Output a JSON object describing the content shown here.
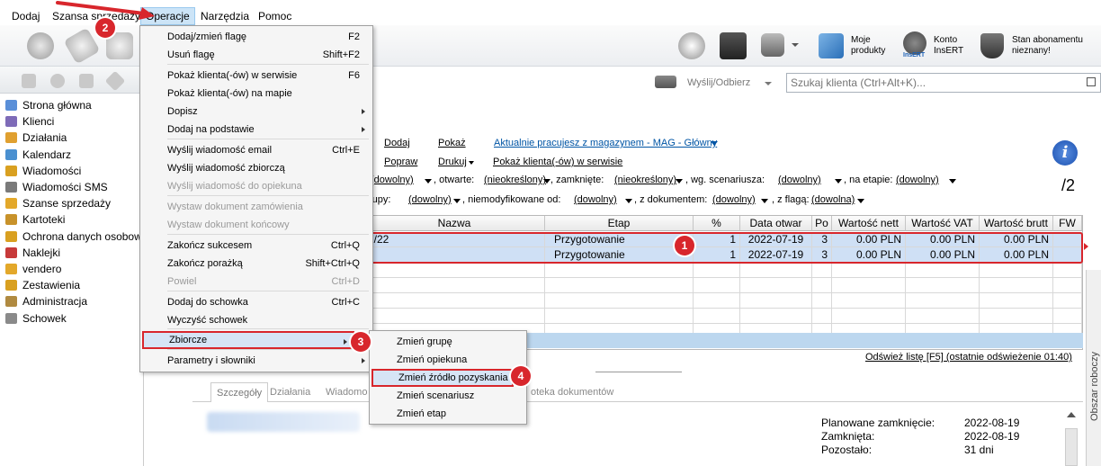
{
  "menubar": {
    "items": [
      "Dodaj",
      "Szansa sprzedaży",
      "Operacje",
      "Narzędzia",
      "Pomoc"
    ]
  },
  "toolbar": {
    "moje_produkty": "Moje\nprodukty",
    "konto_insert": "Konto\nInsERT",
    "subscription": "Stan abonamentu\nnieznany!",
    "insert_logo": "InsERT"
  },
  "sidebar": {
    "items": [
      {
        "label": "Strona główna",
        "color": "#5a8fd8"
      },
      {
        "label": "Klienci",
        "color": "#7e6bb8"
      },
      {
        "label": "Działania",
        "color": "#e0a030"
      },
      {
        "label": "Kalendarz",
        "color": "#4a90d0"
      },
      {
        "label": "Wiadomości",
        "color": "#d9a020"
      },
      {
        "label": "Wiadomości SMS",
        "color": "#7a7a7a"
      },
      {
        "label": "Szanse sprzedaży",
        "color": "#e3a82a"
      },
      {
        "label": "Kartoteki",
        "color": "#c8922a"
      },
      {
        "label": "Ochrona danych osobowych",
        "color": "#d9a020"
      },
      {
        "label": "Naklejki",
        "color": "#c73a3a"
      },
      {
        "label": "vendero",
        "color": "#e3a82a"
      },
      {
        "label": "Zestawienia",
        "color": "#d9a020"
      },
      {
        "label": "Administracja",
        "color": "#b08a40"
      },
      {
        "label": "Schowek",
        "color": "#8a8a8a"
      }
    ]
  },
  "main": {
    "send_receive": "Wyślij/Odbierz",
    "search_placeholder": "Szukaj klienta (Ctrl+Alt+K)...",
    "actions": {
      "dodaj": "Dodaj",
      "pokaz": "Pokaż",
      "popraw": "Popraw",
      "drukuj": "Drukuj",
      "warehouse": "Aktualnie pracujesz z magazynem - MAG - Główny",
      "show_clients": "Pokaż klienta(-ów) w serwisie"
    },
    "filters": {
      "line1": [
        {
          "label": "",
          "value": "(dowolny)"
        },
        {
          "label": ", otwarte:",
          "value": "(nieokreślony)"
        },
        {
          "label": ", zamknięte:",
          "value": "(nieokreślony)"
        },
        {
          "label": ", wg. scenariusza:",
          "value": "(dowolny)"
        },
        {
          "label": ", na etapie:",
          "value": "(dowolny)"
        }
      ],
      "line2": [
        {
          "label": "rupy:",
          "value": "(dowolny)"
        },
        {
          "label": ", niemodyfikowane od:",
          "value": "(dowolny)"
        },
        {
          "label": ", z dokumentem:",
          "value": "(dowolny)"
        },
        {
          "label": ", z flagą:",
          "value": "(dowolna)"
        }
      ]
    },
    "page_count": "/2",
    "info_icon": "i",
    "grid": {
      "headers": [
        "Nazwa",
        "Etap",
        "%",
        "Data otwar",
        "Po",
        "Wartość nett",
        "Wartość VAT",
        "Wartość brutt",
        "FW"
      ],
      "rows": [
        [
          "7/22",
          "Przygotowanie",
          "1",
          "2022-07-19",
          "3",
          "0.00 PLN",
          "0.00 PLN",
          "0.00 PLN",
          ""
        ],
        [
          "",
          "Przygotowanie",
          "1",
          "2022-07-19",
          "3",
          "0.00 PLN",
          "0.00 PLN",
          "0.00 PLN",
          ""
        ]
      ]
    },
    "refresh": "Odśwież listę [F5] (ostatnie odświeżenie 01:40)",
    "tabs": [
      "Szczegóły",
      "Działania",
      "Wiadomo",
      "oteka dokumentów"
    ],
    "details": [
      {
        "label": "Planowane zamknięcie:",
        "value": "2022-08-19"
      },
      {
        "label": "Zamknięta:",
        "value": "2022-08-19"
      },
      {
        "label": "Pozostało:",
        "value": "31 dni"
      }
    ],
    "side_panel": "Obszar roboczy"
  },
  "operacje_menu": [
    {
      "label": "Dodaj/zmień flagę",
      "shortcut": "F2"
    },
    {
      "label": "Usuń flagę",
      "shortcut": "Shift+F2"
    },
    {
      "label": "Pokaż klienta(-ów) w serwisie",
      "shortcut": "F6"
    },
    {
      "label": "Pokaż klienta(-ów) na mapie",
      "shortcut": ""
    },
    {
      "label": "Dopisz",
      "shortcut": ""
    },
    {
      "label": "Dodaj na podstawie",
      "shortcut": ""
    },
    {
      "label": "Wyślij wiadomość email",
      "shortcut": "Ctrl+E"
    },
    {
      "label": "Wyślij wiadomość zbiorczą",
      "shortcut": ""
    },
    {
      "label": "Wyślij wiadomość do opiekuna",
      "shortcut": ""
    },
    {
      "label": "Wystaw dokument zamówienia",
      "shortcut": ""
    },
    {
      "label": "Wystaw dokument końcowy",
      "shortcut": ""
    },
    {
      "label": "Zakończ sukcesem",
      "shortcut": "Ctrl+Q"
    },
    {
      "label": "Zakończ porażką",
      "shortcut": "Shift+Ctrl+Q"
    },
    {
      "label": "Powiel",
      "shortcut": "Ctrl+D"
    },
    {
      "label": "Dodaj do schowka",
      "shortcut": "Ctrl+C"
    },
    {
      "label": "Wyczyść schowek",
      "shortcut": ""
    },
    {
      "label": "Zbiorcze",
      "shortcut": ""
    },
    {
      "label": "Parametry i słowniki",
      "shortcut": ""
    }
  ],
  "zbiorcze_submenu": [
    "Zmień grupę",
    "Zmień opiekuna",
    "Zmień źródło pozyskania",
    "Zmień scenariusz",
    "Zmień etap"
  ],
  "badges": [
    "1",
    "2",
    "3",
    "4"
  ]
}
